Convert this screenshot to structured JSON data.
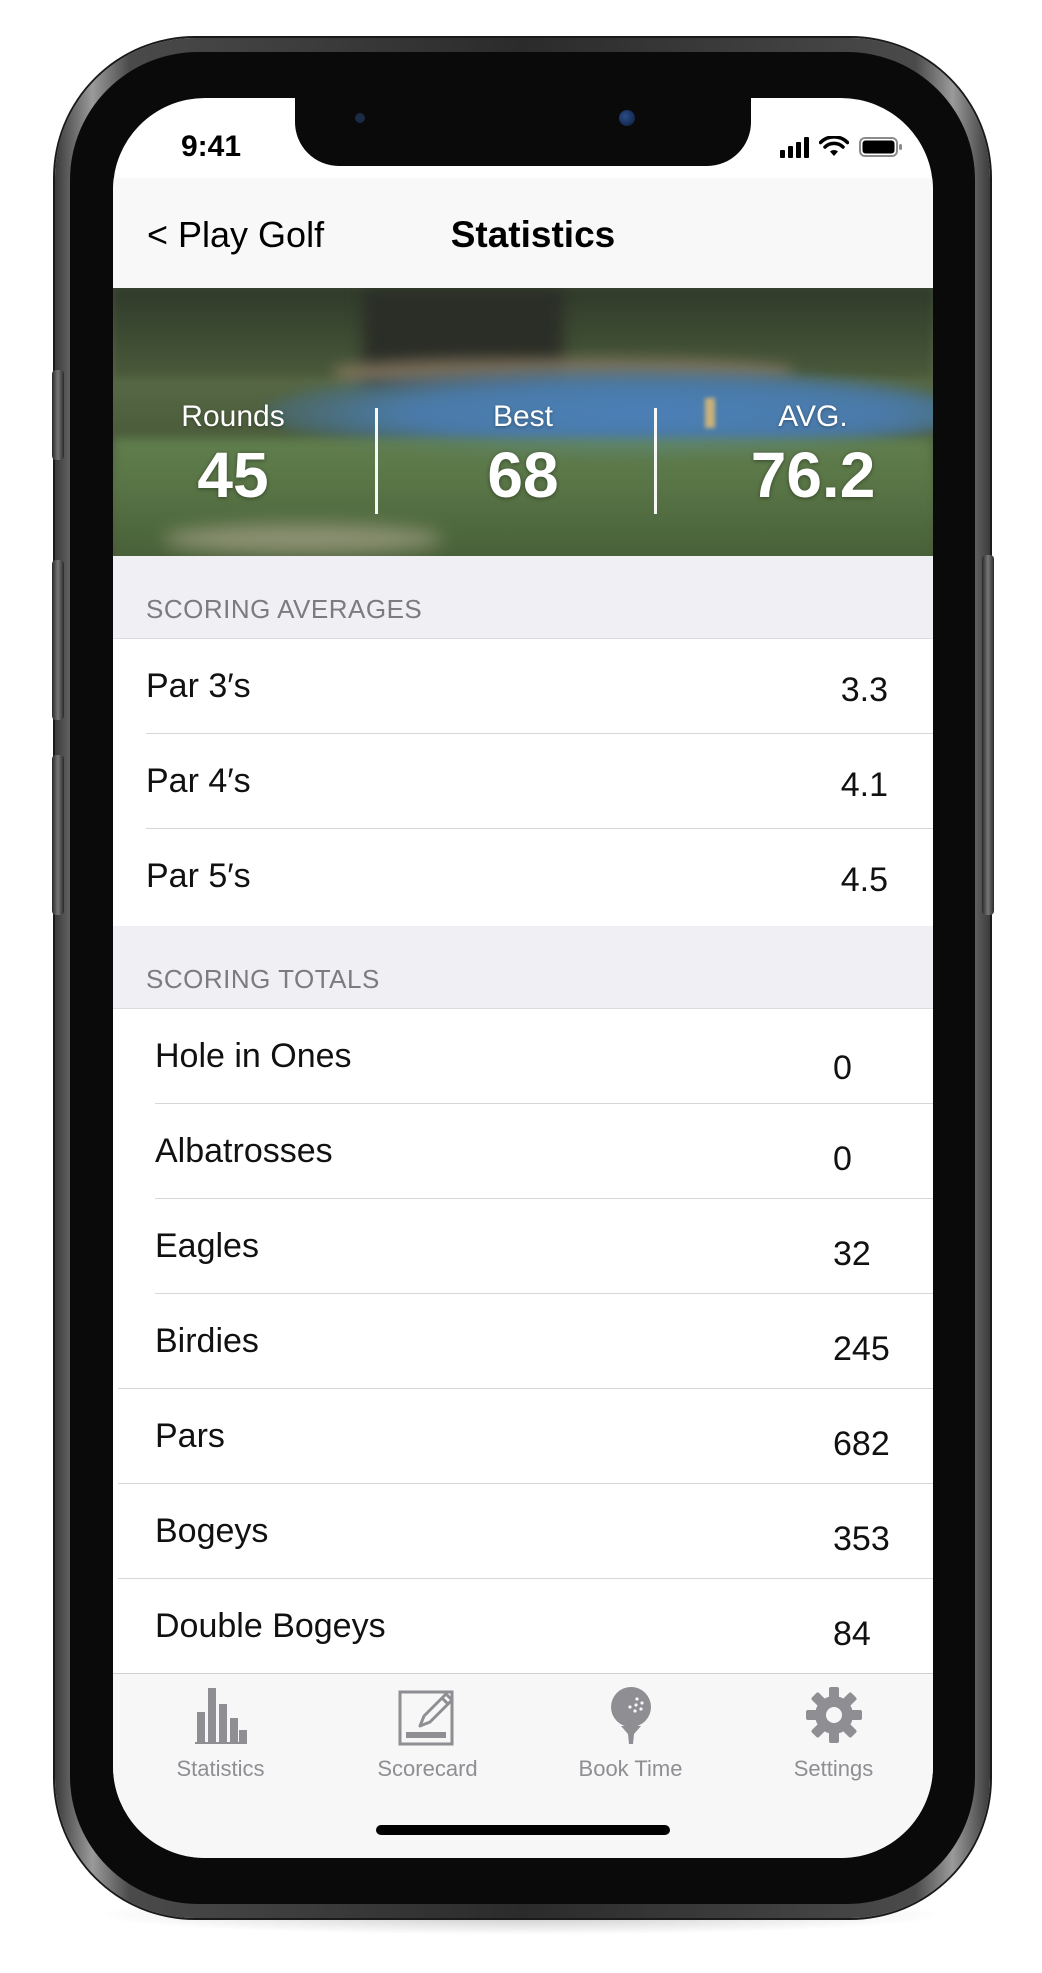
{
  "status_bar": {
    "time": "9:41"
  },
  "nav": {
    "back_label": "< Play Golf",
    "title": "Statistics"
  },
  "summary": [
    {
      "label": "Rounds",
      "value": "45"
    },
    {
      "label": "Best",
      "value": "68"
    },
    {
      "label": "AVG.",
      "value": "76.2"
    }
  ],
  "scoring_averages": {
    "header": "SCORING AVERAGES",
    "rows": [
      {
        "label": "Par 3′s",
        "value": "3.3"
      },
      {
        "label": "Par 4′s",
        "value": "4.1"
      },
      {
        "label": "Par 5′s",
        "value": "4.5"
      }
    ]
  },
  "scoring_totals": {
    "header": "SCORING TOTALS",
    "rows": [
      {
        "label": "Hole in Ones",
        "value": "0"
      },
      {
        "label": "Albatrosses",
        "value": "0"
      },
      {
        "label": "Eagles",
        "value": "32"
      },
      {
        "label": "Birdies",
        "value": "245"
      },
      {
        "label": "Pars",
        "value": "682"
      },
      {
        "label": "Bogeys",
        "value": "353"
      },
      {
        "label": "Double Bogeys",
        "value": "84"
      }
    ]
  },
  "tab_bar": {
    "tabs": [
      {
        "label": "Statistics",
        "icon": "bar-chart-icon"
      },
      {
        "label": "Scorecard",
        "icon": "edit-card-icon"
      },
      {
        "label": "Book Time",
        "icon": "golf-ball-tee-icon"
      },
      {
        "label": "Settings",
        "icon": "gear-icon"
      }
    ]
  },
  "colors": {
    "section_header_bg": "#efeff4",
    "tab_inactive": "#8e8e93",
    "hero_text": "#ffffff"
  }
}
